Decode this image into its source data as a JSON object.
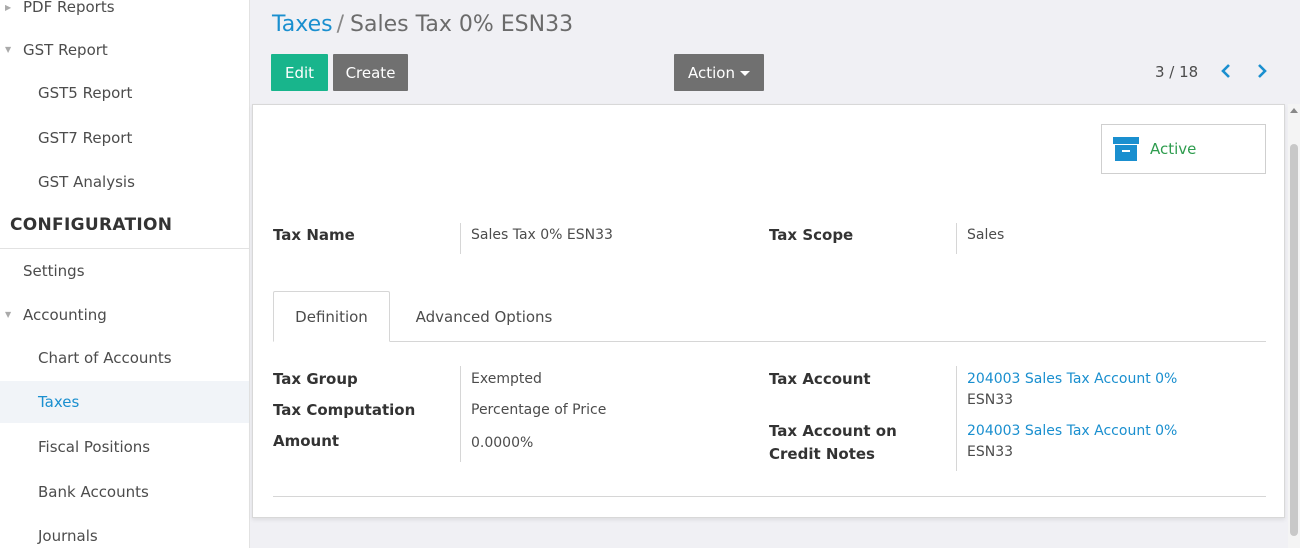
{
  "sidebar": {
    "items": [
      {
        "label": "PDF Reports"
      },
      {
        "label": "GST Report"
      },
      {
        "label": "GST5 Report"
      },
      {
        "label": "GST7 Report"
      },
      {
        "label": "GST Analysis"
      },
      {
        "label": "CONFIGURATION"
      },
      {
        "label": "Settings"
      },
      {
        "label": "Accounting"
      },
      {
        "label": "Chart of Accounts"
      },
      {
        "label": "Taxes"
      },
      {
        "label": "Fiscal Positions"
      },
      {
        "label": "Bank Accounts"
      },
      {
        "label": "Journals"
      }
    ]
  },
  "breadcrumb": {
    "parent": "Taxes",
    "separator": "/",
    "current": "Sales Tax 0% ESN33"
  },
  "toolbar": {
    "edit_label": "Edit",
    "create_label": "Create",
    "action_label": "Action"
  },
  "pager": {
    "value": "3 / 18",
    "prev_icon": "chevron-left-icon",
    "next_icon": "chevron-right-icon"
  },
  "status": {
    "active_label": "Active",
    "icon": "archive-icon"
  },
  "form": {
    "tax_name_label": "Tax Name",
    "tax_name_value": "Sales Tax 0% ESN33",
    "tax_scope_label": "Tax Scope",
    "tax_scope_value": "Sales"
  },
  "tabs": [
    {
      "label": "Definition",
      "active": true
    },
    {
      "label": "Advanced Options",
      "active": false
    }
  ],
  "definition": {
    "tax_group_label": "Tax Group",
    "tax_group_value": "Exempted",
    "tax_computation_label": "Tax Computation",
    "tax_computation_value": "Percentage of Price",
    "amount_label": "Amount",
    "amount_value": "0.0000%",
    "tax_account_label": "Tax Account",
    "tax_account_link": "204003 Sales Tax Account 0%",
    "tax_account_sub": "ESN33",
    "tax_account_credit_label_1": "Tax Account on",
    "tax_account_credit_label_2": "Credit Notes",
    "tax_account_credit_link": "204003 Sales Tax Account 0%",
    "tax_account_credit_sub": "ESN33"
  },
  "colors": {
    "accent": "#1a8fcf",
    "edit_button": "#18b58c",
    "secondary_button": "#707070",
    "active_status": "#2e9c4e"
  }
}
